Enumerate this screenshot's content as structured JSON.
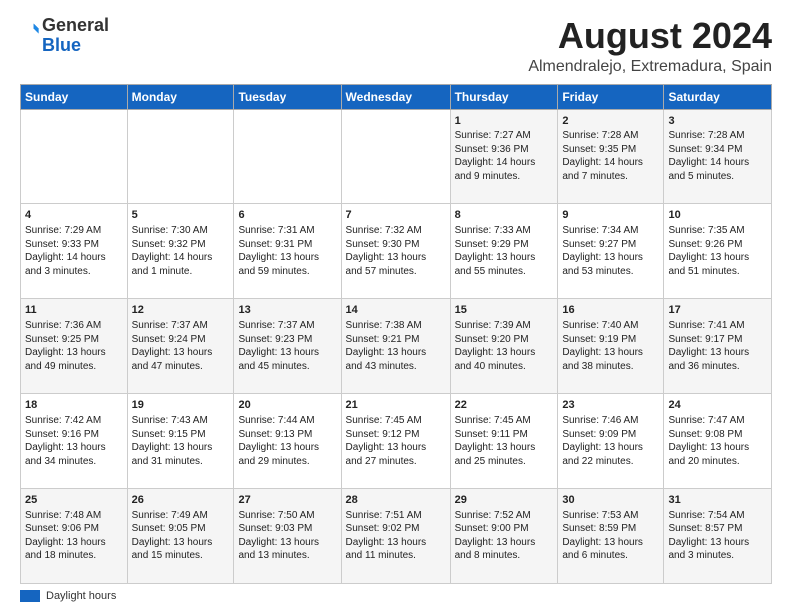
{
  "header": {
    "logo_line1": "General",
    "logo_line2": "Blue",
    "title": "August 2024",
    "subtitle": "Almendralejo, Extremadura, Spain"
  },
  "weekdays": [
    "Sunday",
    "Monday",
    "Tuesday",
    "Wednesday",
    "Thursday",
    "Friday",
    "Saturday"
  ],
  "weeks": [
    [
      {
        "day": "",
        "info": ""
      },
      {
        "day": "",
        "info": ""
      },
      {
        "day": "",
        "info": ""
      },
      {
        "day": "",
        "info": ""
      },
      {
        "day": "1",
        "info": "Sunrise: 7:27 AM\nSunset: 9:36 PM\nDaylight: 14 hours\nand 9 minutes."
      },
      {
        "day": "2",
        "info": "Sunrise: 7:28 AM\nSunset: 9:35 PM\nDaylight: 14 hours\nand 7 minutes."
      },
      {
        "day": "3",
        "info": "Sunrise: 7:28 AM\nSunset: 9:34 PM\nDaylight: 14 hours\nand 5 minutes."
      }
    ],
    [
      {
        "day": "4",
        "info": "Sunrise: 7:29 AM\nSunset: 9:33 PM\nDaylight: 14 hours\nand 3 minutes."
      },
      {
        "day": "5",
        "info": "Sunrise: 7:30 AM\nSunset: 9:32 PM\nDaylight: 14 hours\nand 1 minute."
      },
      {
        "day": "6",
        "info": "Sunrise: 7:31 AM\nSunset: 9:31 PM\nDaylight: 13 hours\nand 59 minutes."
      },
      {
        "day": "7",
        "info": "Sunrise: 7:32 AM\nSunset: 9:30 PM\nDaylight: 13 hours\nand 57 minutes."
      },
      {
        "day": "8",
        "info": "Sunrise: 7:33 AM\nSunset: 9:29 PM\nDaylight: 13 hours\nand 55 minutes."
      },
      {
        "day": "9",
        "info": "Sunrise: 7:34 AM\nSunset: 9:27 PM\nDaylight: 13 hours\nand 53 minutes."
      },
      {
        "day": "10",
        "info": "Sunrise: 7:35 AM\nSunset: 9:26 PM\nDaylight: 13 hours\nand 51 minutes."
      }
    ],
    [
      {
        "day": "11",
        "info": "Sunrise: 7:36 AM\nSunset: 9:25 PM\nDaylight: 13 hours\nand 49 minutes."
      },
      {
        "day": "12",
        "info": "Sunrise: 7:37 AM\nSunset: 9:24 PM\nDaylight: 13 hours\nand 47 minutes."
      },
      {
        "day": "13",
        "info": "Sunrise: 7:37 AM\nSunset: 9:23 PM\nDaylight: 13 hours\nand 45 minutes."
      },
      {
        "day": "14",
        "info": "Sunrise: 7:38 AM\nSunset: 9:21 PM\nDaylight: 13 hours\nand 43 minutes."
      },
      {
        "day": "15",
        "info": "Sunrise: 7:39 AM\nSunset: 9:20 PM\nDaylight: 13 hours\nand 40 minutes."
      },
      {
        "day": "16",
        "info": "Sunrise: 7:40 AM\nSunset: 9:19 PM\nDaylight: 13 hours\nand 38 minutes."
      },
      {
        "day": "17",
        "info": "Sunrise: 7:41 AM\nSunset: 9:17 PM\nDaylight: 13 hours\nand 36 minutes."
      }
    ],
    [
      {
        "day": "18",
        "info": "Sunrise: 7:42 AM\nSunset: 9:16 PM\nDaylight: 13 hours\nand 34 minutes."
      },
      {
        "day": "19",
        "info": "Sunrise: 7:43 AM\nSunset: 9:15 PM\nDaylight: 13 hours\nand 31 minutes."
      },
      {
        "day": "20",
        "info": "Sunrise: 7:44 AM\nSunset: 9:13 PM\nDaylight: 13 hours\nand 29 minutes."
      },
      {
        "day": "21",
        "info": "Sunrise: 7:45 AM\nSunset: 9:12 PM\nDaylight: 13 hours\nand 27 minutes."
      },
      {
        "day": "22",
        "info": "Sunrise: 7:45 AM\nSunset: 9:11 PM\nDaylight: 13 hours\nand 25 minutes."
      },
      {
        "day": "23",
        "info": "Sunrise: 7:46 AM\nSunset: 9:09 PM\nDaylight: 13 hours\nand 22 minutes."
      },
      {
        "day": "24",
        "info": "Sunrise: 7:47 AM\nSunset: 9:08 PM\nDaylight: 13 hours\nand 20 minutes."
      }
    ],
    [
      {
        "day": "25",
        "info": "Sunrise: 7:48 AM\nSunset: 9:06 PM\nDaylight: 13 hours\nand 18 minutes."
      },
      {
        "day": "26",
        "info": "Sunrise: 7:49 AM\nSunset: 9:05 PM\nDaylight: 13 hours\nand 15 minutes."
      },
      {
        "day": "27",
        "info": "Sunrise: 7:50 AM\nSunset: 9:03 PM\nDaylight: 13 hours\nand 13 minutes."
      },
      {
        "day": "28",
        "info": "Sunrise: 7:51 AM\nSunset: 9:02 PM\nDaylight: 13 hours\nand 11 minutes."
      },
      {
        "day": "29",
        "info": "Sunrise: 7:52 AM\nSunset: 9:00 PM\nDaylight: 13 hours\nand 8 minutes."
      },
      {
        "day": "30",
        "info": "Sunrise: 7:53 AM\nSunset: 8:59 PM\nDaylight: 13 hours\nand 6 minutes."
      },
      {
        "day": "31",
        "info": "Sunrise: 7:54 AM\nSunset: 8:57 PM\nDaylight: 13 hours\nand 3 minutes."
      }
    ]
  ],
  "footer": {
    "legend_label": "Daylight hours"
  }
}
